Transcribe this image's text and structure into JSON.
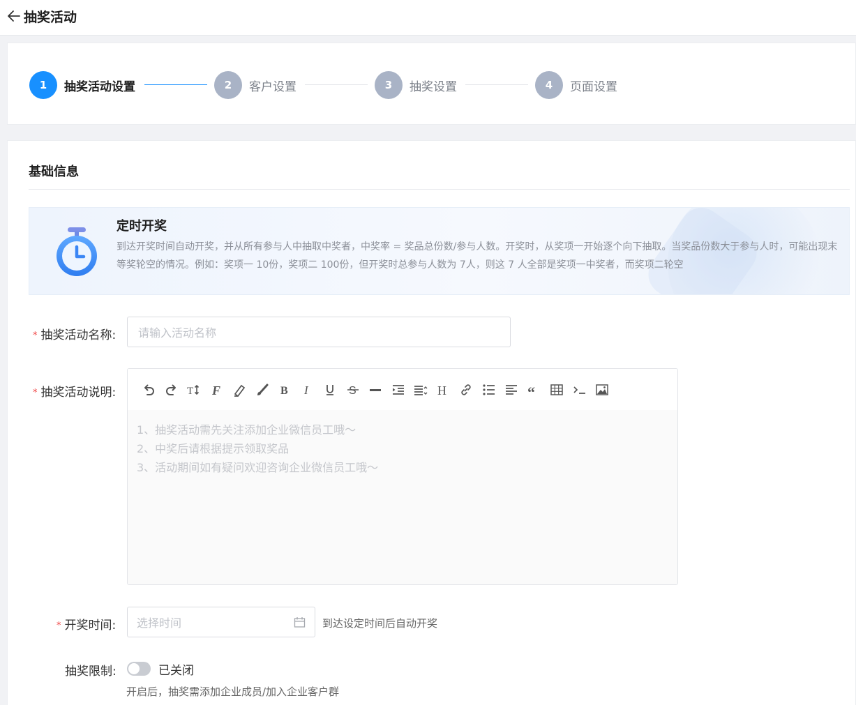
{
  "header": {
    "title": "抽奖活动"
  },
  "steps": [
    {
      "number": "1",
      "label": "抽奖活动设置",
      "active": true
    },
    {
      "number": "2",
      "label": "客户设置",
      "active": false
    },
    {
      "number": "3",
      "label": "抽奖设置",
      "active": false
    },
    {
      "number": "4",
      "label": "页面设置",
      "active": false
    }
  ],
  "colors": {
    "accent": "#1890ff",
    "inactive_step": "#a9b3c6",
    "required": "#f04848"
  },
  "section": {
    "title": "基础信息"
  },
  "banner": {
    "icon": "stopwatch-icon",
    "title": "定时开奖",
    "description": "到达开奖时间自动开奖，并从所有参与人中抽取中奖者，中奖率 = 奖品总份数/参与人数。开奖时，从奖项一开始逐个向下抽取。当奖品份数大于参与人时，可能出现末等奖轮空的情况。例如：奖项一 10份，奖项二 100份，但开奖时总参与人数为 7人，则这 7 人全部是奖项一中奖者，而奖项二轮空"
  },
  "form": {
    "name": {
      "required_mark": "*",
      "label": "抽奖活动名称:",
      "placeholder": "请输入活动名称",
      "value": ""
    },
    "description": {
      "required_mark": "*",
      "label": "抽奖活动说明:",
      "toolbar": [
        "undo-icon",
        "redo-icon",
        "font-size-icon",
        "font-family-icon",
        "highlight-icon",
        "brush-icon",
        "bold-icon",
        "italic-icon",
        "underline-icon",
        "strikethrough-icon",
        "horizontal-rule-icon",
        "indent-icon",
        "line-height-icon",
        "heading-icon",
        "link-icon",
        "bullet-list-icon",
        "align-icon",
        "quote-icon",
        "table-icon",
        "code-icon",
        "image-icon"
      ],
      "placeholder_lines": [
        "1、抽奖活动需先关注添加企业微信员工哦～",
        "2、中奖后请根据提示领取奖品",
        "3、活动期间如有疑问欢迎咨询企业微信员工哦～"
      ]
    },
    "draw_time": {
      "required_mark": "*",
      "label": "开奖时间:",
      "placeholder": "选择时间",
      "hint": "到达设定时间后自动开奖"
    },
    "limit": {
      "label": "抽奖限制:",
      "state": "已关闭",
      "enabled": false,
      "hint": "开启后，抽奖需添加企业成员/加入企业客户群"
    }
  }
}
